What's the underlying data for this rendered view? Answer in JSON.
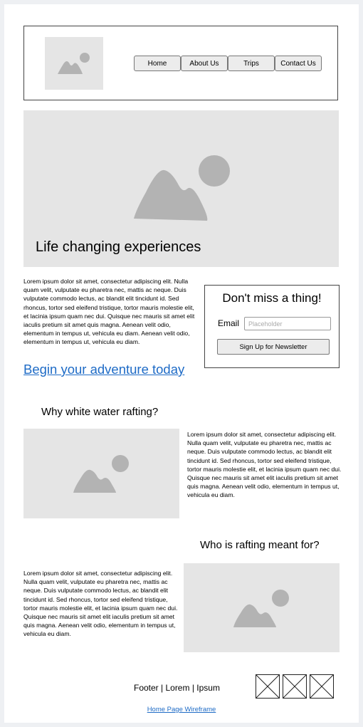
{
  "nav": {
    "items": [
      "Home",
      "About Us",
      "Trips",
      "Contact Us"
    ]
  },
  "hero": {
    "title": "Life changing experiences"
  },
  "intro": {
    "text": "Lorem ipsum dolor sit amet, consectetur adipiscing elit. Nulla quam velit, vulputate eu pharetra nec, mattis ac neque. Duis vulputate commodo lectus, ac blandit elit tincidunt id. Sed rhoncus, tortor sed eleifend tristique, tortor mauris molestie elit, et lacinia ipsum quam nec dui. Quisque nec mauris sit amet elit iaculis pretium sit amet quis magna. Aenean velit odio, elementum in tempus ut, vehicula eu diam. Aenean velit odio, elementum in tempus ut, vehicula eu diam."
  },
  "cta": {
    "label": "Begin your adventure today"
  },
  "newsletter": {
    "title": "Don't miss a thing!",
    "email_label": "Email",
    "placeholder": "Placeholder",
    "button_label": "Sign Up for Newsletter"
  },
  "section1": {
    "heading": "Why white water rafting?",
    "text": "Lorem ipsum dolor sit amet, consectetur adipiscing elit. Nulla quam velit, vulputate eu pharetra nec, mattis ac neque. Duis vulputate commodo lectus, ac blandit elit tincidunt id. Sed rhoncus, tortor sed eleifend tristique, tortor mauris molestie elit, et lacinia ipsum quam nec dui. Quisque nec mauris sit amet elit iaculis pretium sit amet quis magna. Aenean velit odio, elementum in tempus ut, vehicula eu diam."
  },
  "section2": {
    "heading": "Who is rafting meant for?",
    "text": "Lorem ipsum dolor sit amet, consectetur adipiscing elit. Nulla quam velit, vulputate eu pharetra nec, mattis ac neque. Duis vulputate commodo lectus, ac blandit elit tincidunt id. Sed rhoncus, tortor sed eleifend tristique, tortor mauris molestie elit, et lacinia ipsum quam nec dui. Quisque nec mauris sit amet elit iaculis pretium sit amet quis magna. Aenean velit odio, elementum in tempus ut, vehicula eu diam."
  },
  "footer": {
    "text": "Footer | Lorem | Ipsum",
    "wireframe_link": "Home Page Wireframe"
  },
  "colors": {
    "placeholder_bg": "#e5e5e5",
    "placeholder_icon": "#b3b3b3",
    "link": "#1e6bc6"
  },
  "icons": [
    "logo-image-icon",
    "hero-image-icon",
    "section1-image-icon",
    "section2-image-icon",
    "social-x-icon"
  ]
}
